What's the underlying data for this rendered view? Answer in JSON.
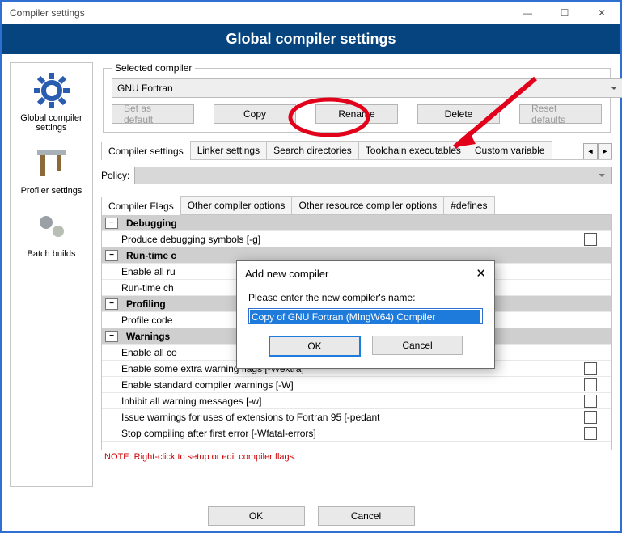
{
  "window": {
    "title": "Compiler settings"
  },
  "banner": "Global compiler settings",
  "sidebar": {
    "items": [
      {
        "label": "Global compiler settings",
        "icon": "gear-large-icon"
      },
      {
        "label": "Profiler settings",
        "icon": "caliper-icon"
      },
      {
        "label": "Batch builds",
        "icon": "gears-small-icon"
      }
    ]
  },
  "selected_compiler": {
    "legend": "Selected compiler",
    "value": "GNU Fortran",
    "buttons": {
      "set_default": "Set as default",
      "copy": "Copy",
      "rename": "Rename",
      "delete": "Delete",
      "reset": "Reset defaults"
    }
  },
  "tabs": {
    "items": [
      "Compiler settings",
      "Linker settings",
      "Search directories",
      "Toolchain executables",
      "Custom variable"
    ],
    "active": 0
  },
  "policy_label": "Policy:",
  "subtabs": {
    "items": [
      "Compiler Flags",
      "Other compiler options",
      "Other resource compiler options",
      "#defines"
    ],
    "active": 0
  },
  "flags": {
    "groups": [
      {
        "name": "Debugging",
        "items": [
          {
            "label": "Produce debugging symbols  [-g]"
          }
        ]
      },
      {
        "name": "Run-time checks",
        "truncated_name": "Run-time c",
        "items": [
          {
            "label": "Enable all run-time checks",
            "truncated": "Enable all ru"
          },
          {
            "label": "Run-time check",
            "truncated": "Run-time ch"
          }
        ]
      },
      {
        "name": "Profiling",
        "items": [
          {
            "label": "Profile code",
            "truncated": "Profile code"
          }
        ]
      },
      {
        "name": "Warnings",
        "items": [
          {
            "label": "Enable all common warnings",
            "truncated": "Enable all co"
          },
          {
            "label": "Enable some extra warning flags  [-Wextra]"
          },
          {
            "label": "Enable standard compiler warnings  [-W]"
          },
          {
            "label": "Inhibit all warning messages  [-w]"
          },
          {
            "label": "Issue warnings for uses of extensions to Fortran 95   [-pedant"
          },
          {
            "label": "Stop compiling after first error  [-Wfatal-errors]"
          }
        ]
      }
    ],
    "note": "NOTE: Right-click to setup or edit compiler flags."
  },
  "footer": {
    "ok": "OK",
    "cancel": "Cancel"
  },
  "modal": {
    "title": "Add new compiler",
    "prompt": "Please enter the new compiler's name:",
    "value": "Copy of GNU Fortran (MIngW64) Compiler",
    "ok": "OK",
    "cancel": "Cancel"
  }
}
